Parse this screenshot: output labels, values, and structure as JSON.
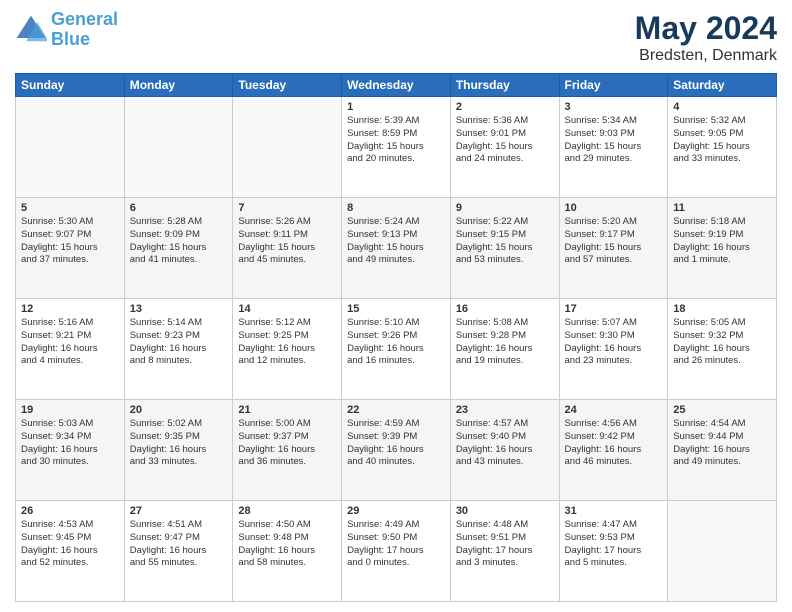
{
  "logo": {
    "line1": "General",
    "line2": "Blue"
  },
  "title": "May 2024",
  "subtitle": "Bredsten, Denmark",
  "days_header": [
    "Sunday",
    "Monday",
    "Tuesday",
    "Wednesday",
    "Thursday",
    "Friday",
    "Saturday"
  ],
  "weeks": [
    {
      "cells": [
        {
          "day": "",
          "content": ""
        },
        {
          "day": "",
          "content": ""
        },
        {
          "day": "",
          "content": ""
        },
        {
          "day": "1",
          "content": "Sunrise: 5:39 AM\nSunset: 8:59 PM\nDaylight: 15 hours\nand 20 minutes."
        },
        {
          "day": "2",
          "content": "Sunrise: 5:36 AM\nSunset: 9:01 PM\nDaylight: 15 hours\nand 24 minutes."
        },
        {
          "day": "3",
          "content": "Sunrise: 5:34 AM\nSunset: 9:03 PM\nDaylight: 15 hours\nand 29 minutes."
        },
        {
          "day": "4",
          "content": "Sunrise: 5:32 AM\nSunset: 9:05 PM\nDaylight: 15 hours\nand 33 minutes."
        }
      ]
    },
    {
      "cells": [
        {
          "day": "5",
          "content": "Sunrise: 5:30 AM\nSunset: 9:07 PM\nDaylight: 15 hours\nand 37 minutes."
        },
        {
          "day": "6",
          "content": "Sunrise: 5:28 AM\nSunset: 9:09 PM\nDaylight: 15 hours\nand 41 minutes."
        },
        {
          "day": "7",
          "content": "Sunrise: 5:26 AM\nSunset: 9:11 PM\nDaylight: 15 hours\nand 45 minutes."
        },
        {
          "day": "8",
          "content": "Sunrise: 5:24 AM\nSunset: 9:13 PM\nDaylight: 15 hours\nand 49 minutes."
        },
        {
          "day": "9",
          "content": "Sunrise: 5:22 AM\nSunset: 9:15 PM\nDaylight: 15 hours\nand 53 minutes."
        },
        {
          "day": "10",
          "content": "Sunrise: 5:20 AM\nSunset: 9:17 PM\nDaylight: 15 hours\nand 57 minutes."
        },
        {
          "day": "11",
          "content": "Sunrise: 5:18 AM\nSunset: 9:19 PM\nDaylight: 16 hours\nand 1 minute."
        }
      ]
    },
    {
      "cells": [
        {
          "day": "12",
          "content": "Sunrise: 5:16 AM\nSunset: 9:21 PM\nDaylight: 16 hours\nand 4 minutes."
        },
        {
          "day": "13",
          "content": "Sunrise: 5:14 AM\nSunset: 9:23 PM\nDaylight: 16 hours\nand 8 minutes."
        },
        {
          "day": "14",
          "content": "Sunrise: 5:12 AM\nSunset: 9:25 PM\nDaylight: 16 hours\nand 12 minutes."
        },
        {
          "day": "15",
          "content": "Sunrise: 5:10 AM\nSunset: 9:26 PM\nDaylight: 16 hours\nand 16 minutes."
        },
        {
          "day": "16",
          "content": "Sunrise: 5:08 AM\nSunset: 9:28 PM\nDaylight: 16 hours\nand 19 minutes."
        },
        {
          "day": "17",
          "content": "Sunrise: 5:07 AM\nSunset: 9:30 PM\nDaylight: 16 hours\nand 23 minutes."
        },
        {
          "day": "18",
          "content": "Sunrise: 5:05 AM\nSunset: 9:32 PM\nDaylight: 16 hours\nand 26 minutes."
        }
      ]
    },
    {
      "cells": [
        {
          "day": "19",
          "content": "Sunrise: 5:03 AM\nSunset: 9:34 PM\nDaylight: 16 hours\nand 30 minutes."
        },
        {
          "day": "20",
          "content": "Sunrise: 5:02 AM\nSunset: 9:35 PM\nDaylight: 16 hours\nand 33 minutes."
        },
        {
          "day": "21",
          "content": "Sunrise: 5:00 AM\nSunset: 9:37 PM\nDaylight: 16 hours\nand 36 minutes."
        },
        {
          "day": "22",
          "content": "Sunrise: 4:59 AM\nSunset: 9:39 PM\nDaylight: 16 hours\nand 40 minutes."
        },
        {
          "day": "23",
          "content": "Sunrise: 4:57 AM\nSunset: 9:40 PM\nDaylight: 16 hours\nand 43 minutes."
        },
        {
          "day": "24",
          "content": "Sunrise: 4:56 AM\nSunset: 9:42 PM\nDaylight: 16 hours\nand 46 minutes."
        },
        {
          "day": "25",
          "content": "Sunrise: 4:54 AM\nSunset: 9:44 PM\nDaylight: 16 hours\nand 49 minutes."
        }
      ]
    },
    {
      "cells": [
        {
          "day": "26",
          "content": "Sunrise: 4:53 AM\nSunset: 9:45 PM\nDaylight: 16 hours\nand 52 minutes."
        },
        {
          "day": "27",
          "content": "Sunrise: 4:51 AM\nSunset: 9:47 PM\nDaylight: 16 hours\nand 55 minutes."
        },
        {
          "day": "28",
          "content": "Sunrise: 4:50 AM\nSunset: 9:48 PM\nDaylight: 16 hours\nand 58 minutes."
        },
        {
          "day": "29",
          "content": "Sunrise: 4:49 AM\nSunset: 9:50 PM\nDaylight: 17 hours\nand 0 minutes."
        },
        {
          "day": "30",
          "content": "Sunrise: 4:48 AM\nSunset: 9:51 PM\nDaylight: 17 hours\nand 3 minutes."
        },
        {
          "day": "31",
          "content": "Sunrise: 4:47 AM\nSunset: 9:53 PM\nDaylight: 17 hours\nand 5 minutes."
        },
        {
          "day": "",
          "content": ""
        }
      ]
    }
  ]
}
